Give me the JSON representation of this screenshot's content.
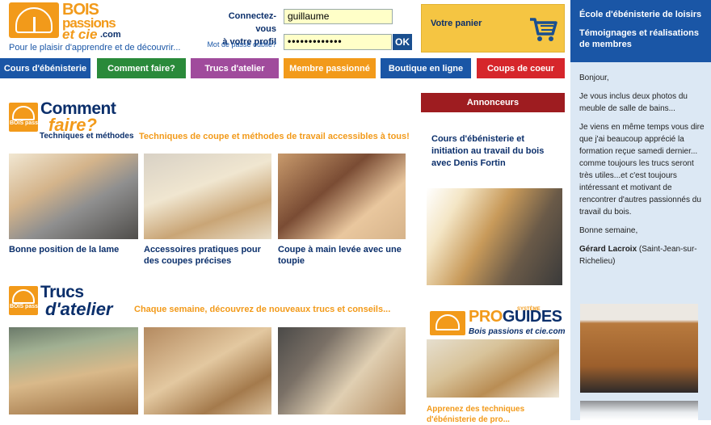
{
  "logo": {
    "line1": "BOIS",
    "line2": "passions",
    "line3": "et cie",
    "line4": ".com"
  },
  "tagline": "Pour le plaisir d'apprendre et de découvrir...",
  "login": {
    "label1": "Connectez-vous",
    "label2": "à votre profil",
    "username": "guillaume",
    "password": "•••••••••••••",
    "forgot": "Mot de passe oublié?",
    "ok": "OK"
  },
  "cart": {
    "label": "Votre panier",
    "icon": "cart-icon"
  },
  "nav": [
    {
      "label": "Cours d'ébénisterie",
      "color": "#1a56a6"
    },
    {
      "label": "Comment faire?",
      "color": "#2a8a3a"
    },
    {
      "label": "Trucs d'atelier",
      "color": "#a04b9c"
    },
    {
      "label": "Membre passionné",
      "color": "#f29a1a"
    },
    {
      "label": "Boutique en ligne",
      "color": "#1a56a6"
    },
    {
      "label": "Coups de coeur",
      "color": "#d6262b"
    }
  ],
  "panel": {
    "head1": "École d'ébénisterie de loisirs",
    "head2": "Témoignages et réalisations de membres",
    "p1": "Bonjour,",
    "p2": "Je vous inclus deux photos du meuble de salle de bains...",
    "p3": "Je viens en même temps vous dire que j'ai beaucoup apprécié la formation reçue samedi dernier...  comme toujours les trucs seront très utiles...et c'est toujours intéressant et motivant de rencontrer d'autres passionnés du travail du bois.",
    "p4": "Bonne semaine,",
    "author": "Gérard Lacroix",
    "place": " (Saint-Jean-sur-Richelieu)"
  },
  "comment": {
    "logo_small": "BOIS passions et cie",
    "title1": "Comment",
    "title2": "faire?",
    "subtitle": "Techniques et méthodes",
    "tagline": "Techniques de coupe et méthodes de travail accessibles à tous!",
    "items": [
      {
        "caption": "Bonne position de la lame"
      },
      {
        "caption": "Accessoires pratiques pour des coupes précises"
      },
      {
        "caption": "Coupe à main levée avec une toupie"
      }
    ]
  },
  "trucs": {
    "logo_small": "BOIS passions et cie",
    "title1": "Trucs",
    "title2": "d'atelier",
    "tagline": "Chaque semaine, découvrez de nouveaux trucs et conseils..."
  },
  "annonceurs": {
    "label": "Annonceurs",
    "ad_text": "Cours d'ébénisterie et initiation au travail du bois avec Denis Fortin"
  },
  "proguides": {
    "pro": "PRO",
    "guides": "GUIDES",
    "systeme": "SYSTÈME",
    "sub": "Bois passions et cie.com",
    "text": "Apprenez des techniques d'ébénisterie de pro..."
  }
}
